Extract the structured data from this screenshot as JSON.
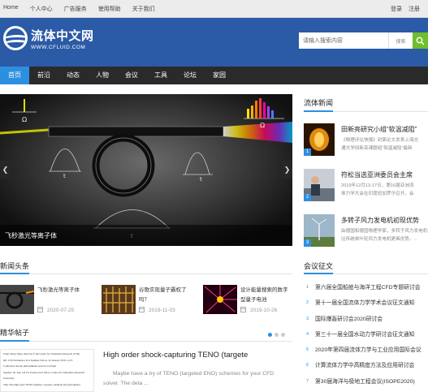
{
  "topbar": {
    "links": [
      "Home",
      "个人中心",
      "广告服务",
      "使用帮助",
      "关于我们"
    ],
    "login": "登录",
    "register": "注册"
  },
  "header": {
    "logo_cn": "流体中文网",
    "logo_en": "WWW.CFLUID.COM",
    "search_placeholder": "请输入搜索内容",
    "search_button": "搜索"
  },
  "nav": {
    "items": [
      "首页",
      "前沿",
      "动态",
      "人物",
      "会议",
      "工具",
      "论坛",
      "家园"
    ],
    "active_index": 0
  },
  "slider": {
    "caption": "飞秒激光等离子体",
    "symbols": {
      "omega": "Ω",
      "t": "t"
    }
  },
  "sections": {
    "news_headline": "新闻头条",
    "fluid_news": "流体新闻",
    "conference": "会议征文",
    "featured": "精华帖子"
  },
  "headlines": [
    {
      "title": "飞秒激光等离子体",
      "date": "2020-07-25"
    },
    {
      "title": "谷歌实现量子霸权了吗？",
      "date": "2019-11-03"
    },
    {
      "title": "设计能量搜索的数字型量子电池",
      "date": "2019-10-26"
    }
  ],
  "fluid_news": [
    {
      "num": "1",
      "title": "田新亮研究小组“软温减阻”",
      "desc1": "《物理评论快报》封面论文发表上海交",
      "desc2": "通大学田新亮课题组“软温减阻”最新"
    },
    {
      "num": "2",
      "title": "符松当选亚洲委员会主席",
      "desc1": "2019年12月13-17日，第16届亚洲流",
      "desc2": "体力学大会在印度班加罗尔召开。会"
    },
    {
      "num": "3",
      "title": "多转子风力发电机初现优势",
      "desc1": "由德国和德国物理学家，多转子风力发电机",
      "desc2": "比传统单叶轮风力发电机更具优势。..."
    }
  ],
  "conferences": [
    {
      "num": "1",
      "title": "第六届全国船舶与海洋工程CFD专题研讨会"
    },
    {
      "num": "2",
      "title": "第十一届全国流体力学学术会议征文通知"
    },
    {
      "num": "3",
      "title": "国际爆轰研讨会2020研讨会"
    },
    {
      "num": "4",
      "title": "第三十一届全国水动力学研讨会征文通知"
    },
    {
      "num": "5",
      "title": "2020年第四届流体力学与工业应用国际会议"
    },
    {
      "num": "6",
      "title": "计算流体力学中高精度方法及应用研讨会"
    },
    {
      "num": "7",
      "title": "第30届海洋与极地工程会议(ISOPE2020)"
    }
  ],
  "featured": {
    "title": "High order shock-capturing TENO (targete",
    "desc_line1": "Maybe have a try of TENO (targeted ENO) schemes for your CFD",
    "desc_line2": "solver. The deta ...",
    "paper_lines": [
      "From: Pieter Mate, Director of the Centre for Turbulence Research (CTR)",
      "",
      "RE: CTR Turbulence Fox Summer Fellow, 26 January 2019, at 4:5",
      "Conference Room, Refreshments served at 4:10pm",
      "",
      "Speaker: Dr.-Ing. Lin Fu, Postdoctoral fellow, Center for Turbulence Research",
      "University",
      "",
      "Title: The high-order TENO schemes: concepts, methods and performance"
    ]
  },
  "colors": {
    "header_bg": "#2b5aa6",
    "nav_bg": "#2a2a2a",
    "nav_active": "#2d8fe0",
    "search_green": "#6fbe2b",
    "accent": "#2d8fe0"
  }
}
